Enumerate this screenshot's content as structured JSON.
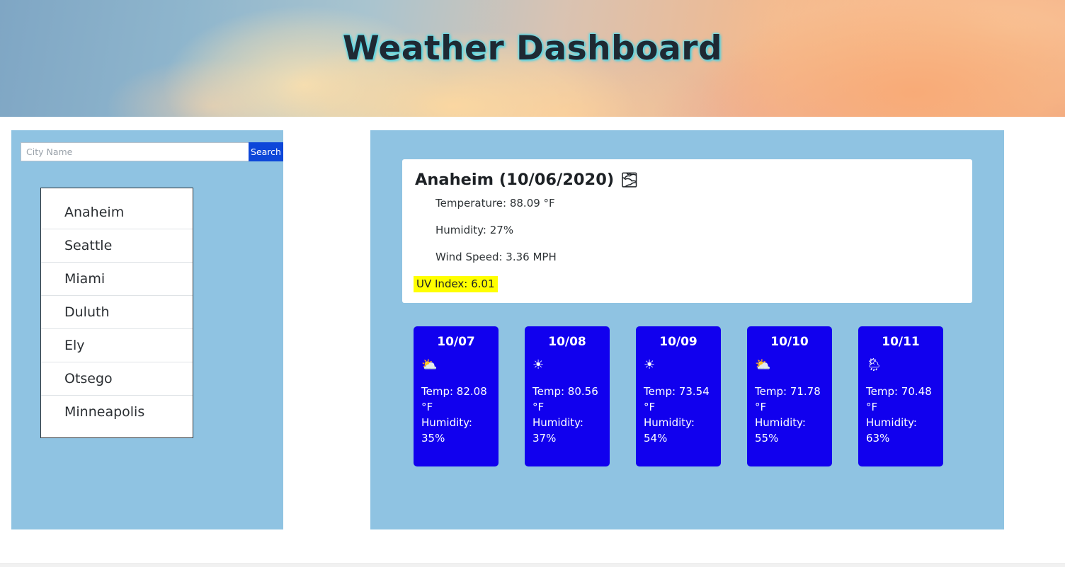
{
  "header": {
    "title": "Weather Dashboard"
  },
  "search": {
    "placeholder": "City Name",
    "value": "",
    "button_label": "Search"
  },
  "city_list": {
    "items": [
      {
        "label": "Anaheim"
      },
      {
        "label": "Seattle"
      },
      {
        "label": "Miami"
      },
      {
        "label": "Duluth"
      },
      {
        "label": "Ely"
      },
      {
        "label": "Otsego"
      },
      {
        "label": "Minneapolis"
      }
    ]
  },
  "current": {
    "heading": "Anaheim (10/06/2020)",
    "icon": "fog-icon",
    "icon_glyph": "🌫",
    "temperature": "Temperature: 88.09 °F",
    "humidity": "Humidity: 27%",
    "wind": "Wind Speed: 3.36 MPH",
    "uv_label": "UV Index: 6.01",
    "uv_highlight_color": "#ffff00"
  },
  "forecast": {
    "cards": [
      {
        "date": "10/07",
        "icon": "sun-behind-cloud-icon",
        "icon_glyph": "⛅",
        "temp": "Temp: 82.08 °F",
        "humidity": "Humidity: 35%"
      },
      {
        "date": "10/08",
        "icon": "sun-icon",
        "icon_glyph": "☀",
        "temp": "Temp: 80.56 °F",
        "humidity": "Humidity: 37%"
      },
      {
        "date": "10/09",
        "icon": "sun-icon",
        "icon_glyph": "☀",
        "temp": "Temp: 73.54 °F",
        "humidity": "Humidity: 54%"
      },
      {
        "date": "10/10",
        "icon": "sun-behind-cloud-icon",
        "icon_glyph": "⛅",
        "temp": "Temp: 71.78 °F",
        "humidity": "Humidity: 55%"
      },
      {
        "date": "10/11",
        "icon": "sun-behind-rain-cloud-icon",
        "icon_glyph": "🌦",
        "temp": "Temp: 70.48 °F",
        "humidity": "Humidity: 63%"
      }
    ]
  },
  "colors": {
    "panel_blue": "#8fc3e2",
    "forecast_blue": "#1100ee",
    "search_button_blue": "#0d47d9",
    "uv_highlight": "#ffff00",
    "title_text": "#1f2933"
  }
}
